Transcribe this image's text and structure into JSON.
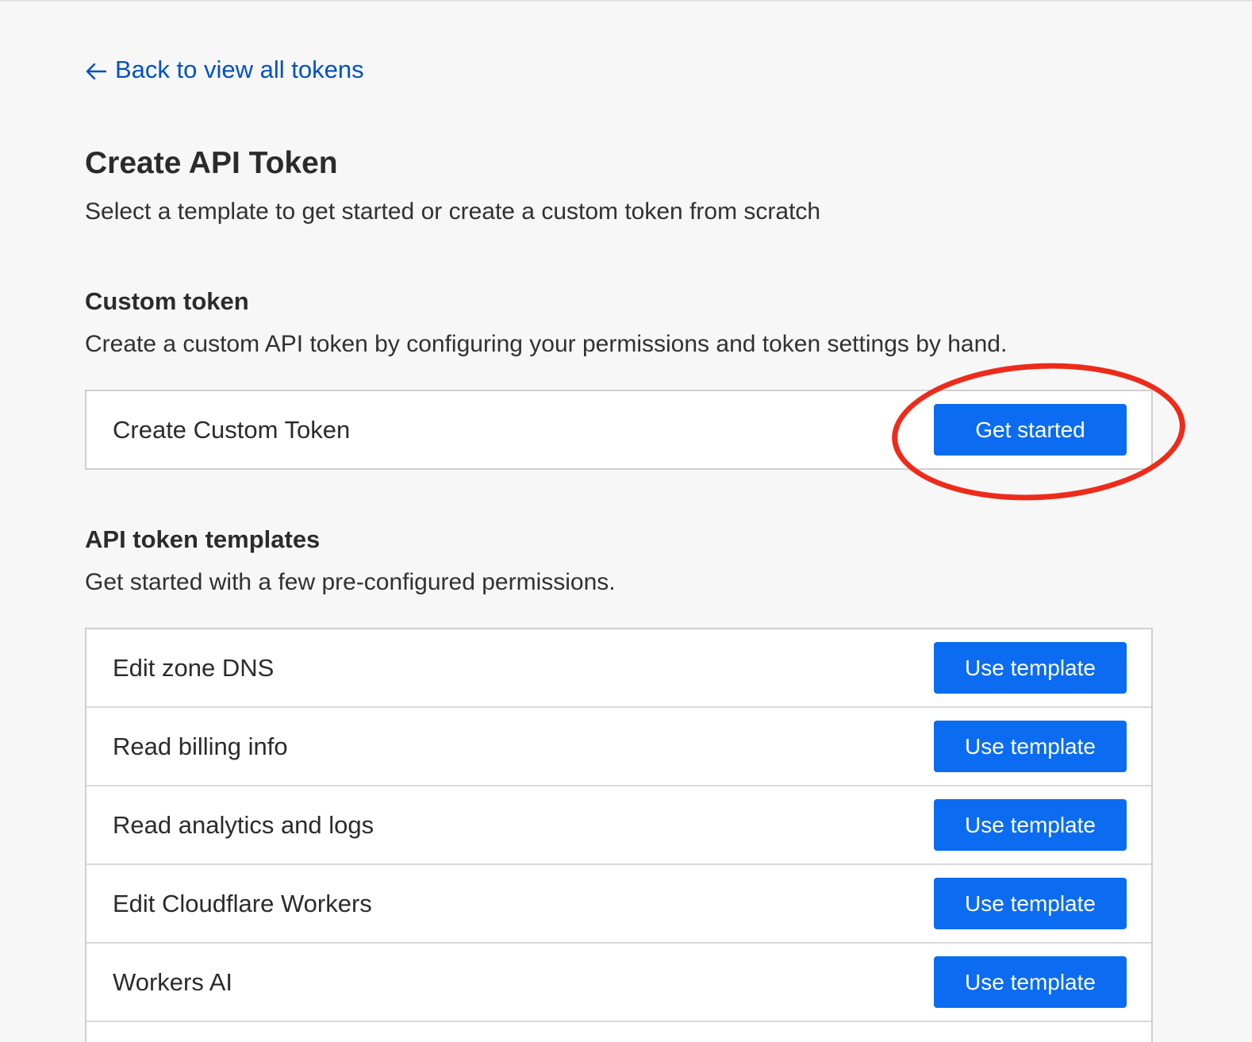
{
  "nav": {
    "back_label": "Back to view all tokens"
  },
  "header": {
    "title": "Create API Token",
    "subtitle": "Select a template to get started or create a custom token from scratch"
  },
  "custom_token": {
    "title": "Custom token",
    "description": "Create a custom API token by configuring your permissions and token settings by hand.",
    "row_label": "Create Custom Token",
    "button_label": "Get started"
  },
  "templates": {
    "title": "API token templates",
    "description": "Get started with a few pre-configured permissions.",
    "items": [
      {
        "label": "Edit zone DNS",
        "button_label": "Use template"
      },
      {
        "label": "Read billing info",
        "button_label": "Use template"
      },
      {
        "label": "Read analytics and logs",
        "button_label": "Use template"
      },
      {
        "label": "Edit Cloudflare Workers",
        "button_label": "Use template"
      },
      {
        "label": "Workers AI",
        "button_label": "Use template"
      }
    ]
  },
  "colors": {
    "link": "#0051c3",
    "button": "#0b6cf2",
    "annotation": "#ee2b1a",
    "background": "#f7f7f7"
  },
  "icons": {
    "back": "arrow-left-icon"
  }
}
